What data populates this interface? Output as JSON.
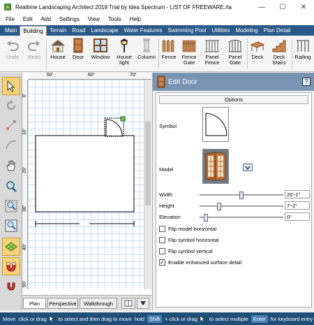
{
  "window": {
    "title": "Realtime Landscaping Architect 2018 Trial by Idea Spectrum - LIST OF FREEWARE.rla",
    "minimize": "—",
    "maximize": "☐",
    "close": "✕"
  },
  "menu": [
    "File",
    "Edit",
    "Add",
    "Settings",
    "View",
    "Tools",
    "Help"
  ],
  "ribbon_tabs": [
    "Main",
    "Building",
    "Terrain",
    "Road",
    "Landscape",
    "Water Features",
    "Swimming Pool",
    "Utilities",
    "Modeling",
    "Plan Detail"
  ],
  "ribbon_active": "Building",
  "ribbon": {
    "undo": "Undo",
    "redo": "Redo",
    "house": "House",
    "door": "Door",
    "window": "Window",
    "house_light": [
      "House",
      "light"
    ],
    "column": "Column",
    "fence": "Fence",
    "fence_gate": [
      "Fence",
      "Gate"
    ],
    "panel_fence": [
      "Panel",
      "Fence"
    ],
    "panel_gate": [
      "Panel",
      "Gate"
    ],
    "deck": "Deck",
    "deck_stairs": [
      "Deck",
      "Stairs"
    ],
    "railing": "Railing"
  },
  "ruler": {
    "top_0": "50'",
    "top_1": "60'",
    "top_2": "70'",
    "left": [
      "0'",
      "10'",
      "20'",
      "30'",
      "40'",
      "50'"
    ]
  },
  "bottom_tabs": [
    "Plan",
    "Perspective",
    "Walkthrough"
  ],
  "panel": {
    "title": "Edit Door",
    "help": "?",
    "options_tab": "Options",
    "symbol_label": "Symbol",
    "model_label": "Model",
    "width_label": "Width",
    "width_value": "20'-1\"",
    "width_pos": 0.5,
    "height_label": "Height",
    "height_value": "7'-2\"",
    "height_pos": 0.22,
    "elevation_label": "Elevation",
    "elevation_value": "0\"",
    "elevation_pos": 0.05,
    "checks": [
      {
        "label": "Flip model horizontal",
        "checked": false
      },
      {
        "label": "Flip symbol horizontal",
        "checked": false
      },
      {
        "label": "Flip symbol vertical",
        "checked": false
      },
      {
        "label": "Enable enhanced surface detail",
        "checked": true
      }
    ]
  },
  "status": {
    "mode": "Move",
    "t1": "click or drag",
    "t2": "to select and then drag to move",
    "hold": "hold",
    "shift": "Shift",
    "t3": "+ click or drag",
    "t4": "to select multiple",
    "enter": "Enter",
    "t5": "for keyboard entry"
  },
  "colors": {
    "accent": "#2b5a8a",
    "panel_head": "#7a94b3",
    "status": "#1f4e79"
  }
}
